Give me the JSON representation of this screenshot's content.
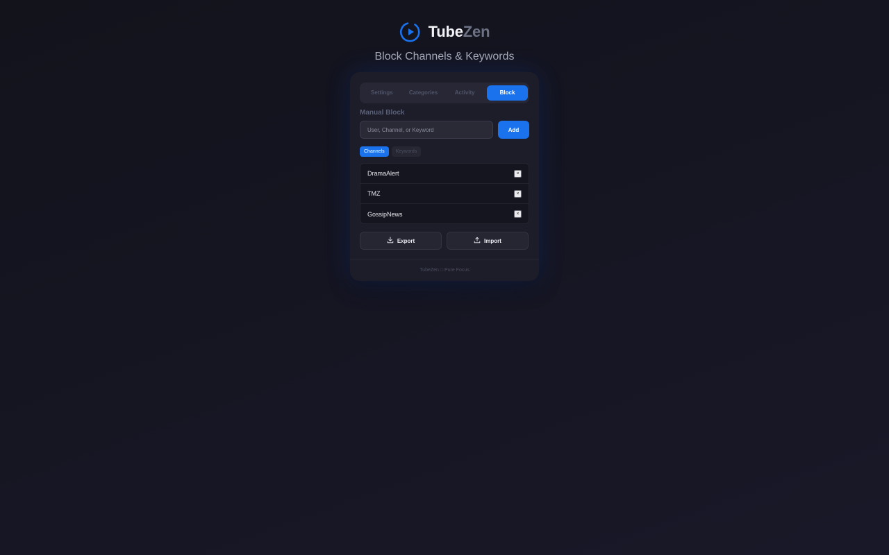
{
  "brand": {
    "name_part1": "Tube",
    "name_part2": "Zen",
    "logo_icon": "play-circle-icon",
    "accent_color": "#1a72ec"
  },
  "subtitle": "Block Channels & Keywords",
  "tabs": [
    {
      "label": "Settings",
      "active": false
    },
    {
      "label": "Categories",
      "active": false
    },
    {
      "label": "Activity",
      "active": false
    },
    {
      "label": "Block",
      "active": true
    }
  ],
  "manual_block": {
    "title": "Manual Block",
    "input_placeholder": "User, Channel, or Keyword",
    "input_value": "",
    "add_label": "Add"
  },
  "subtabs": [
    {
      "label": "Channels",
      "active": true
    },
    {
      "label": "Keywords",
      "active": false
    }
  ],
  "blocked_list": [
    {
      "label": "DramaAlert",
      "remove_label": "×"
    },
    {
      "label": "TMZ",
      "remove_label": "×"
    },
    {
      "label": "GossipNews",
      "remove_label": "×"
    }
  ],
  "actions": {
    "export_label": "Export",
    "export_icon": "download-icon",
    "import_label": "Import",
    "import_icon": "upload-icon"
  },
  "footer": "TubeZen □ Pure Focus"
}
